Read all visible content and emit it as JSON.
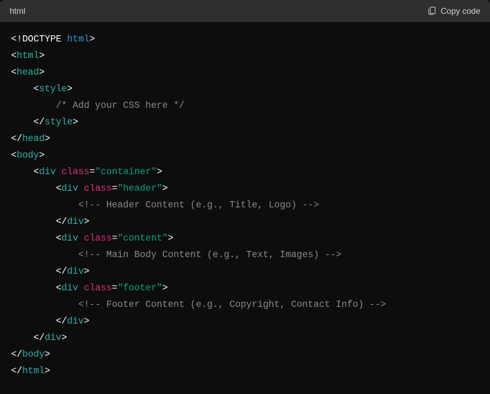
{
  "header": {
    "language_label": "html",
    "copy_button_label": "Copy code"
  },
  "code": {
    "lines": [
      [
        [
          "white",
          "<!DOCTYPE "
        ],
        [
          "blue",
          "html"
        ],
        [
          "white",
          ">"
        ]
      ],
      [
        [
          "white",
          "<"
        ],
        [
          "teal",
          "html"
        ],
        [
          "white",
          ">"
        ]
      ],
      [
        [
          "white",
          "<"
        ],
        [
          "teal",
          "head"
        ],
        [
          "white",
          ">"
        ]
      ],
      [
        [
          "white",
          "    <"
        ],
        [
          "teal",
          "style"
        ],
        [
          "white",
          ">"
        ]
      ],
      [
        [
          "gray",
          "        /* Add your CSS here */"
        ]
      ],
      [
        [
          "white",
          "    </"
        ],
        [
          "teal",
          "style"
        ],
        [
          "white",
          ">"
        ]
      ],
      [
        [
          "white",
          "</"
        ],
        [
          "teal",
          "head"
        ],
        [
          "white",
          ">"
        ]
      ],
      [
        [
          "white",
          "<"
        ],
        [
          "teal",
          "body"
        ],
        [
          "white",
          ">"
        ]
      ],
      [
        [
          "white",
          "    <"
        ],
        [
          "teal",
          "div"
        ],
        [
          "white",
          " "
        ],
        [
          "pink",
          "class"
        ],
        [
          "white",
          "="
        ],
        [
          "green",
          "\"container\""
        ],
        [
          "white",
          ">"
        ]
      ],
      [
        [
          "white",
          "        <"
        ],
        [
          "teal",
          "div"
        ],
        [
          "white",
          " "
        ],
        [
          "pink",
          "class"
        ],
        [
          "white",
          "="
        ],
        [
          "green",
          "\"header\""
        ],
        [
          "white",
          ">"
        ]
      ],
      [
        [
          "gray",
          "            <!-- Header Content (e.g., Title, Logo) -->"
        ]
      ],
      [
        [
          "white",
          "        </"
        ],
        [
          "teal",
          "div"
        ],
        [
          "white",
          ">"
        ]
      ],
      [
        [
          "white",
          "        <"
        ],
        [
          "teal",
          "div"
        ],
        [
          "white",
          " "
        ],
        [
          "pink",
          "class"
        ],
        [
          "white",
          "="
        ],
        [
          "green",
          "\"content\""
        ],
        [
          "white",
          ">"
        ]
      ],
      [
        [
          "gray",
          "            <!-- Main Body Content (e.g., Text, Images) -->"
        ]
      ],
      [
        [
          "white",
          "        </"
        ],
        [
          "teal",
          "div"
        ],
        [
          "white",
          ">"
        ]
      ],
      [
        [
          "white",
          "        <"
        ],
        [
          "teal",
          "div"
        ],
        [
          "white",
          " "
        ],
        [
          "pink",
          "class"
        ],
        [
          "white",
          "="
        ],
        [
          "green",
          "\"footer\""
        ],
        [
          "white",
          ">"
        ]
      ],
      [
        [
          "gray",
          "            <!-- Footer Content (e.g., Copyright, Contact Info) -->"
        ]
      ],
      [
        [
          "white",
          "        </"
        ],
        [
          "teal",
          "div"
        ],
        [
          "white",
          ">"
        ]
      ],
      [
        [
          "white",
          "    </"
        ],
        [
          "teal",
          "div"
        ],
        [
          "white",
          ">"
        ]
      ],
      [
        [
          "white",
          "</"
        ],
        [
          "teal",
          "body"
        ],
        [
          "white",
          ">"
        ]
      ],
      [
        [
          "white",
          "</"
        ],
        [
          "teal",
          "html"
        ],
        [
          "white",
          ">"
        ]
      ]
    ]
  }
}
